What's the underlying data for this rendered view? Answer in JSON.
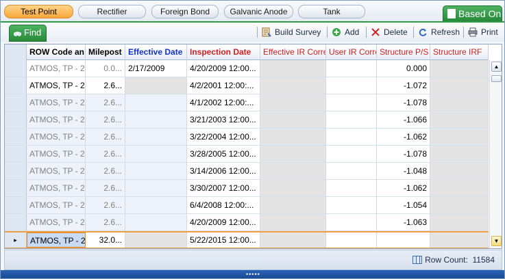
{
  "tabs": [
    {
      "label": "Test Point",
      "active": true
    },
    {
      "label": "Rectifier",
      "active": false
    },
    {
      "label": "Foreign Bond",
      "active": false
    },
    {
      "label": "Galvanic Anode",
      "active": false
    },
    {
      "label": "Tank",
      "active": false
    }
  ],
  "based_on_label": "Based On",
  "find_label": "Find",
  "toolbar": {
    "build_survey": "Build Survey",
    "add": "Add",
    "delete": "Delete",
    "refresh": "Refresh",
    "print": "Print"
  },
  "columns": [
    "ROW Code an",
    "Milepost",
    "Effective Date",
    "Inspection Date",
    "Effective IR Corre",
    "User IR Corre",
    "Structure P/S",
    "Structure IRF"
  ],
  "rows": [
    {
      "row": "ATMOS, TP - 2",
      "milepost": "0.0...",
      "effective": "2/17/2009",
      "inspection": "4/20/2009 12:00...",
      "eir": "",
      "uir": "",
      "ps": "0.000",
      "irf": ""
    },
    {
      "row": "ATMOS, TP - 2",
      "milepost": "2.6...",
      "effective": "",
      "inspection": "4/2/2001 12:00:...",
      "eir": "",
      "uir": "",
      "ps": "-1.072",
      "irf": ""
    },
    {
      "row": "ATMOS, TP - 2",
      "milepost": "2.6...",
      "effective": "",
      "inspection": "4/1/2002 12:00:...",
      "eir": "",
      "uir": "",
      "ps": "-1.078",
      "irf": ""
    },
    {
      "row": "ATMOS, TP - 2",
      "milepost": "2.6...",
      "effective": "",
      "inspection": "3/21/2003 12:00...",
      "eir": "",
      "uir": "",
      "ps": "-1.066",
      "irf": ""
    },
    {
      "row": "ATMOS, TP - 2",
      "milepost": "2.6...",
      "effective": "",
      "inspection": "3/22/2004 12:00...",
      "eir": "",
      "uir": "",
      "ps": "-1.062",
      "irf": ""
    },
    {
      "row": "ATMOS, TP - 2",
      "milepost": "2.6...",
      "effective": "",
      "inspection": "3/28/2005 12:00...",
      "eir": "",
      "uir": "",
      "ps": "-1.078",
      "irf": ""
    },
    {
      "row": "ATMOS, TP - 2",
      "milepost": "2.6...",
      "effective": "",
      "inspection": "3/14/2006 12:00...",
      "eir": "",
      "uir": "",
      "ps": "-1.048",
      "irf": ""
    },
    {
      "row": "ATMOS, TP - 2",
      "milepost": "2.6...",
      "effective": "",
      "inspection": "3/30/2007 12:00...",
      "eir": "",
      "uir": "",
      "ps": "-1.062",
      "irf": ""
    },
    {
      "row": "ATMOS, TP - 2",
      "milepost": "2.6...",
      "effective": "",
      "inspection": "6/4/2008 12:00:...",
      "eir": "",
      "uir": "",
      "ps": "-1.054",
      "irf": ""
    },
    {
      "row": "ATMOS, TP - 2",
      "milepost": "2.6...",
      "effective": "",
      "inspection": "4/20/2009 12:00...",
      "eir": "",
      "uir": "",
      "ps": "-1.063",
      "irf": ""
    }
  ],
  "last_row": {
    "row": "ATMOS, TP - 2",
    "milepost": "32.0...",
    "effective": "",
    "inspection": "5/22/2015 12:00...",
    "eir": "",
    "uir": "",
    "ps": "",
    "irf": ""
  },
  "row_count_label": "Row Count:",
  "row_count": "11584",
  "colors": {
    "accent_orange": "#f7a63a",
    "green": "#268a3a",
    "blue_header": "#1532c8",
    "red_header": "#d21f1f"
  }
}
